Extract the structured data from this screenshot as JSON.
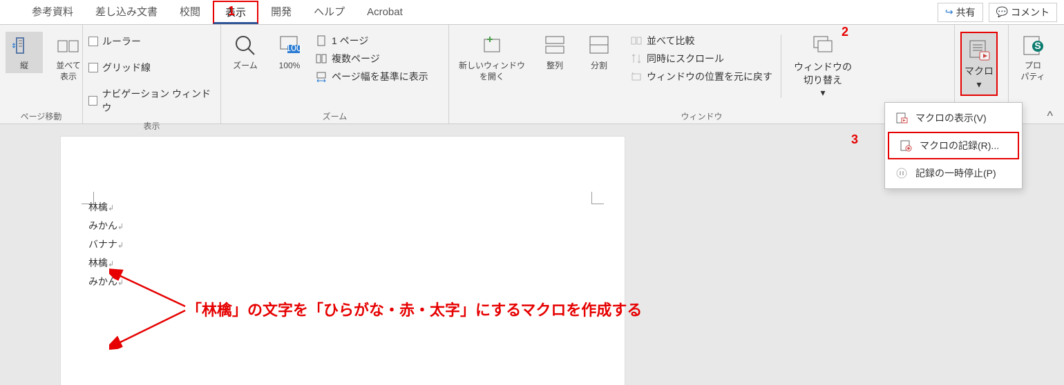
{
  "tabs": [
    "参考資料",
    "差し込み文書",
    "校閲",
    "表示",
    "開発",
    "ヘルプ",
    "Acrobat"
  ],
  "active_tab": "表示",
  "topActions": {
    "share": "共有",
    "comment": "コメント"
  },
  "groups": {
    "pageMove": {
      "label": "ページ移動",
      "vertical": "縦",
      "sideBySide": "並べて\n表示"
    },
    "show": {
      "label": "表示",
      "ruler": "ルーラー",
      "grid": "グリッド線",
      "nav": "ナビゲーション ウィンドウ"
    },
    "zoom": {
      "label": "ズーム",
      "zoom": "ズーム",
      "hundred": "100%",
      "onePage": "1 ページ",
      "multiPage": "複数ページ",
      "fitWidth": "ページ幅を基準に表示"
    },
    "window": {
      "label": "ウィンドウ",
      "newWin": "新しいウィンドウ\nを開く",
      "arrange": "整列",
      "split": "分割",
      "compare": "並べて比較",
      "syncScroll": "同時にスクロール",
      "resetPos": "ウィンドウの位置を元に戻す",
      "switch": "ウィンドウの\n切り替え"
    },
    "macros": {
      "label": "マクロ",
      "macro": "マクロ"
    },
    "props": {
      "label": "",
      "prop": "プロ\nパティ"
    }
  },
  "menu": {
    "view": "マクロの表示(V)",
    "record": "マクロの記録(R)...",
    "pause": "記録の一時停止(P)"
  },
  "doc": [
    "林檎",
    "みかん",
    "バナナ",
    "林檎",
    "みかん"
  ],
  "note": "「林檎」の文字を「ひらがな・赤・太字」にするマクロを作成する",
  "steps": {
    "s1": "1",
    "s2": "2",
    "s3": "3"
  }
}
